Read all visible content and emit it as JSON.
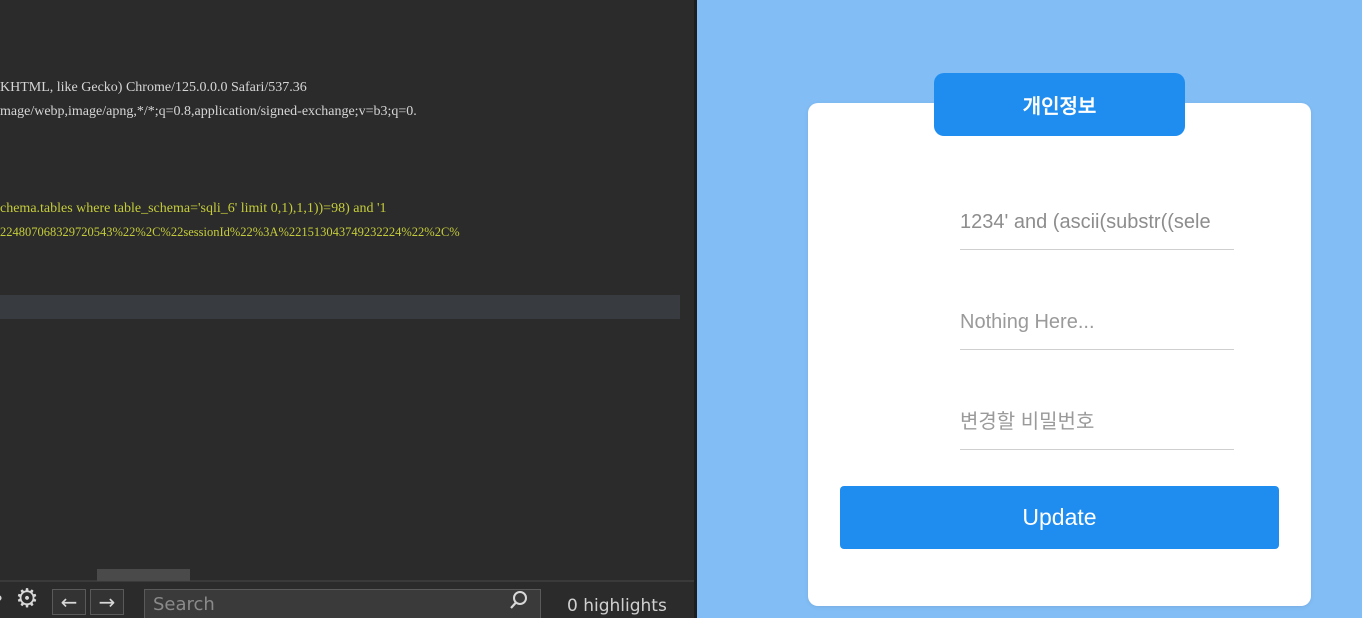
{
  "editor": {
    "lines": [
      {
        "text": "KHTML, like Gecko) Chrome/125.0.0.0 Safari/537.36",
        "style": "white"
      },
      {
        "text": "mage/webp,image/apng,*/*;q=0.8,application/signed-exchange;v=b3;q=0.",
        "style": "white"
      },
      {
        "text": "chema.tables where table_schema='sqli_6' limit 0,1),1,1))=98) and '1",
        "style": "yellow"
      },
      {
        "text": "22480706832972054​3%22%2C%22sessionId%22%3A%221513043749232224%22%2C%",
        "style": "yellow"
      }
    ],
    "search": {
      "placeholder": "Search",
      "highlights": "0 highlights"
    },
    "icons": {
      "help": "help-icon",
      "gear": "gear-icon",
      "prev": "arrow-left-icon",
      "next": "arrow-right-icon",
      "search": "search-icon"
    }
  },
  "form": {
    "title": "개인정보",
    "id_value": "1234' and (ascii(substr((sele",
    "name_placeholder": "Nothing Here...",
    "password_placeholder": "변경할 비밀번호",
    "update_label": "Update"
  },
  "colors": {
    "page_background": "#82bdf5",
    "accent": "#1f8df0",
    "editor_background": "#2b2b2b",
    "editor_text": "#d6d6d6",
    "editor_highlight": "#c4cc3a"
  }
}
